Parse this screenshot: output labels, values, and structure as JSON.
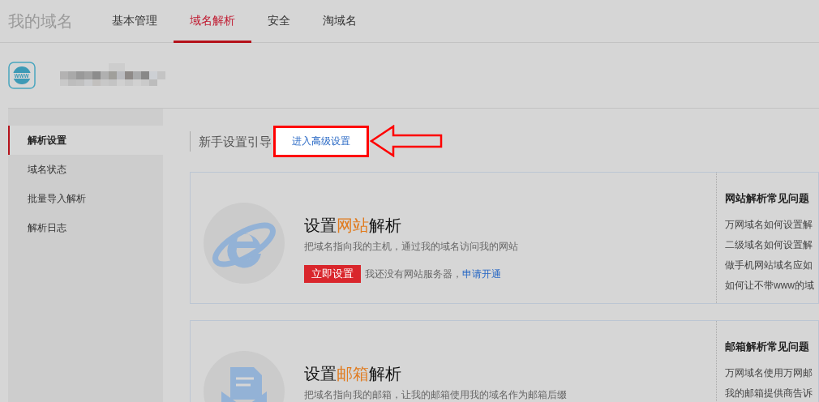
{
  "brand": "我的域名",
  "nav": [
    {
      "label": "基本管理",
      "selected": false
    },
    {
      "label": "域名解析",
      "selected": true
    },
    {
      "label": "安全",
      "selected": false
    },
    {
      "label": "淘域名",
      "selected": false
    }
  ],
  "sidebar": {
    "items": [
      {
        "label": "解析设置",
        "selected": true
      },
      {
        "label": "域名状态",
        "selected": false
      },
      {
        "label": "批量导入解析",
        "selected": false
      },
      {
        "label": "解析日志",
        "selected": false
      }
    ]
  },
  "guide": {
    "title": "新手设置引导",
    "advanced_link": "进入高级设置"
  },
  "cards": [
    {
      "kind": "website",
      "title": [
        "设置",
        "网站",
        "解析"
      ],
      "description": "把域名指向我的主机，通过我的域名访问我的网站",
      "button": "立即设置",
      "note": "我还没有网站服务器，",
      "note_link": "申请开通",
      "faq_title": "网站解析常见问题",
      "faq": [
        "万网域名如何设置解",
        "二级域名如何设置解",
        "做手机网站域名应如",
        "如何让不带www的域"
      ]
    },
    {
      "kind": "mail",
      "title": [
        "设置",
        "邮箱",
        "解析"
      ],
      "description": "把域名指向我的邮箱，让我的邮箱使用我的域名作为邮箱后缀",
      "faq_title": "邮箱解析常见问题",
      "faq": [
        "万网域名使用万网邮",
        "我的邮箱提供商告诉"
      ]
    }
  ]
}
